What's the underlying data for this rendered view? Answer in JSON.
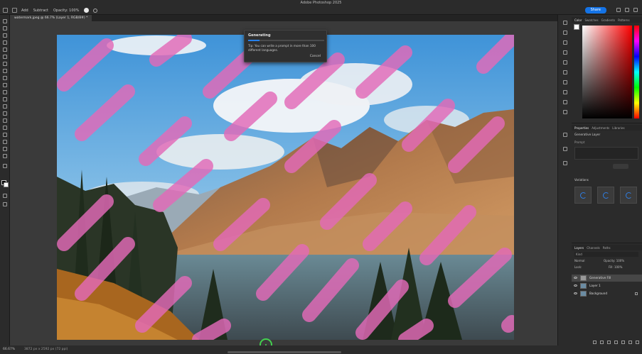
{
  "app": {
    "title": "Adobe Photoshop 2025"
  },
  "options_bar": {
    "mode1": "Add",
    "mode2": "Subtract",
    "opacity": "Opacity: 100%",
    "share_label": "Share"
  },
  "document": {
    "tab_label": "watermark.jpeg @ 66.7% (Layer 1, RGB/8#) *",
    "zoom": "66.67%",
    "info": "3872 px x 2592 px (72 ppi)"
  },
  "dialog": {
    "title": "Generating",
    "tip": "Tip: You can write a prompt in more than 100 different languages.",
    "cancel_label": "Cancel",
    "progress": 0.15
  },
  "color_panel": {
    "tabs": [
      "Color",
      "Swatches",
      "Gradients",
      "Patterns"
    ]
  },
  "properties_panel": {
    "tabs": [
      "Properties",
      "Adjustments",
      "Libraries"
    ],
    "layer_type": "Generative Layer",
    "prompt_label": "Prompt",
    "variations_label": "Variations"
  },
  "layers_panel": {
    "tabs": [
      "Layers",
      "Channels",
      "Paths"
    ],
    "search_label": "Kind",
    "blend_mode": "Normal",
    "opacity": "Opacity: 100%",
    "lock": "Lock:",
    "fill": "Fill: 100%",
    "layers": [
      {
        "name": "Generative Fill"
      },
      {
        "name": "Layer 1"
      },
      {
        "name": "Background"
      }
    ]
  },
  "colors": {
    "accent": "#1473e6",
    "brush_strokes": "#e36ab8",
    "cursor": "#43d14f"
  }
}
